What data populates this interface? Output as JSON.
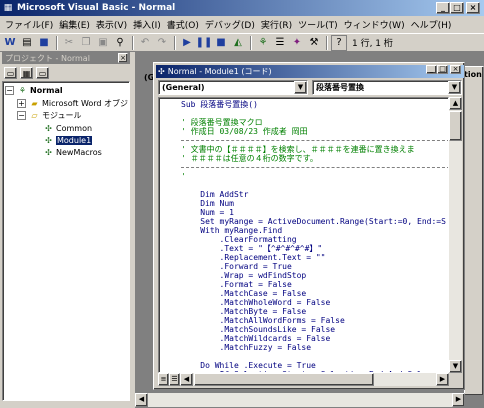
{
  "app": {
    "title": "Microsoft Visual Basic - Normal",
    "icon": "vba-icon"
  },
  "menu": [
    "ファイル(F)",
    "編集(E)",
    "表示(V)",
    "挿入(I)",
    "書式(O)",
    "デバッグ(D)",
    "実行(R)",
    "ツール(T)",
    "ウィンドウ(W)",
    "ヘルプ(H)"
  ],
  "toolbar": {
    "position": "1 行, 1 桁"
  },
  "project": {
    "title": "プロジェクト - Normal",
    "tree": {
      "root": "Normal",
      "word_objects": "Microsoft Word オブジェクト",
      "modules": "モジュール",
      "items": [
        "Common",
        "Module1",
        "NewMacros"
      ]
    }
  },
  "background_window": {
    "label_left": "(G",
    "label_right": "tion"
  },
  "code_window": {
    "title": "Normal - Module1 (コード)",
    "object_combo": "(General)",
    "procedure_combo": "段落番号置換",
    "lines": [
      {
        "t": "kw",
        "text": "Sub 段落番号置換()"
      },
      {
        "t": "blank",
        "text": ""
      },
      {
        "t": "cm",
        "text": "' 段落番号置換マクロ"
      },
      {
        "t": "cm",
        "text": "' 作成日 03/08/23 作成者 岡田"
      },
      {
        "t": "sep",
        "text": ""
      },
      {
        "t": "cm",
        "text": "' 文書中の【＃＃＃＃】を検索し、＃＃＃＃を連番に置き換えま"
      },
      {
        "t": "cm",
        "text": "' ＃＃＃＃は任意の４桁の数字です。"
      },
      {
        "t": "sep",
        "text": ""
      },
      {
        "t": "cm",
        "text": "'"
      },
      {
        "t": "blank",
        "text": ""
      },
      {
        "t": "kw",
        "text": "    Dim AddStr"
      },
      {
        "t": "kw",
        "text": "    Dim Num"
      },
      {
        "t": "kw",
        "text": "    Num = 1"
      },
      {
        "t": "kw",
        "text": "    Set myRange = ActiveDocument.Range(Start:=0, End:=S"
      },
      {
        "t": "kw",
        "text": "    With myRange.Find"
      },
      {
        "t": "kw",
        "text": "        .ClearFormatting"
      },
      {
        "t": "kw",
        "text": "        .Text = \"【^#^#^#^#】\""
      },
      {
        "t": "kw",
        "text": "        .Replacement.Text = \"\""
      },
      {
        "t": "kw",
        "text": "        .Forward = True"
      },
      {
        "t": "kw",
        "text": "        .Wrap = wdFindStop"
      },
      {
        "t": "kw",
        "text": "        .Format = False"
      },
      {
        "t": "kw",
        "text": "        .MatchCase = False"
      },
      {
        "t": "kw",
        "text": "        .MatchWholeWord = False"
      },
      {
        "t": "kw",
        "text": "        .MatchByte = False"
      },
      {
        "t": "kw",
        "text": "        .MatchAllWordForms = False"
      },
      {
        "t": "kw",
        "text": "        .MatchSoundsLike = False"
      },
      {
        "t": "kw",
        "text": "        .MatchWildcards = False"
      },
      {
        "t": "kw",
        "text": "        .MatchFuzzy = False"
      },
      {
        "t": "blank",
        "text": ""
      },
      {
        "t": "kw",
        "text": "    Do While .Execute = True"
      },
      {
        "t": "kw",
        "text": "        If Selection.Start < Selection.End And Sele"
      }
    ]
  }
}
